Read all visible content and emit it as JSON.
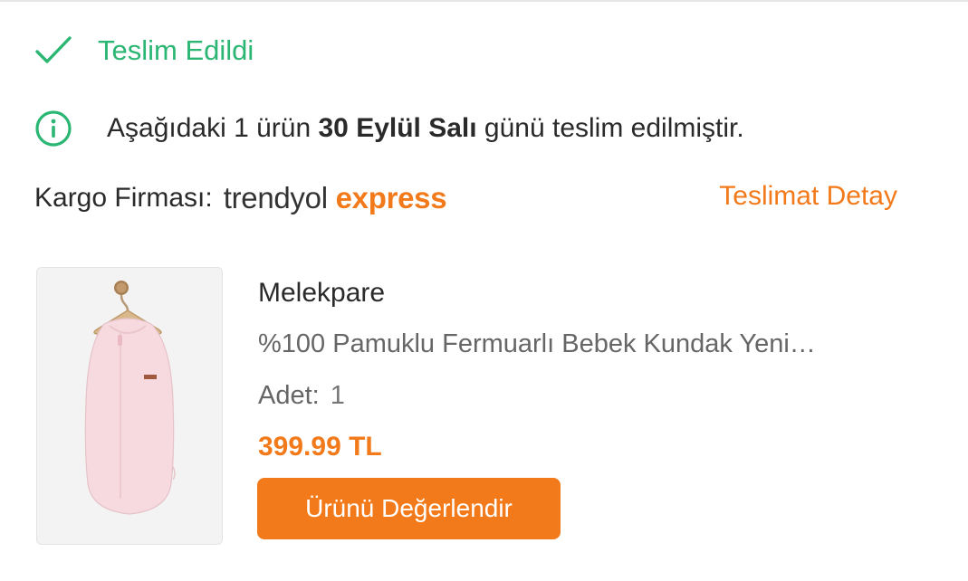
{
  "status": {
    "label": "Teslim Edildi",
    "icon": "check-icon",
    "color": "#2bb673"
  },
  "notice": {
    "icon": "info-icon",
    "prefix": "Aşağıdaki 1 ürün ",
    "date_bold": "30 Eylül Salı",
    "suffix": " günü teslim edilmiştir."
  },
  "cargo": {
    "label": "Kargo Firması:",
    "carrier_part1": "trendyol",
    "carrier_part2": "express",
    "detail_link": "Teslimat Detay"
  },
  "product": {
    "brand": "Melekpare",
    "name": "%100 Pamuklu Fermuarlı Bebek Kundak Yeni…",
    "quantity_label": "Adet:",
    "quantity_value": "1",
    "price": "399.99 TL",
    "review_button": "Ürünü Değerlendir"
  },
  "colors": {
    "accent": "#f27a1a",
    "success": "#2bb673"
  }
}
